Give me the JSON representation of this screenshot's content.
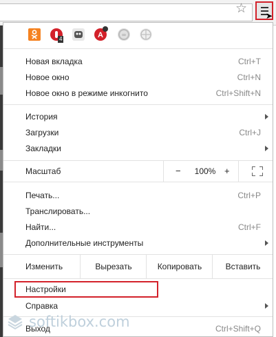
{
  "toolbar": {
    "star_icon": "star-icon",
    "menu_icon": "hamburger-menu-icon"
  },
  "extensions": [
    {
      "name": "odnoklassniki",
      "color": "#f58220"
    },
    {
      "name": "adblock",
      "color": "#d3212a",
      "badge": "4"
    },
    {
      "name": "ghostery",
      "color": "#555555"
    },
    {
      "name": "translate",
      "color": "#d3212a"
    },
    {
      "name": "lastpass",
      "color": "#cccccc"
    },
    {
      "name": "globe",
      "color": "#bfbfbf"
    }
  ],
  "menu": {
    "new_tab": {
      "label": "Новая вкладка",
      "shortcut": "Ctrl+T"
    },
    "new_window": {
      "label": "Новое окно",
      "shortcut": "Ctrl+N"
    },
    "incognito": {
      "label": "Новое окно в режиме инкогнито",
      "shortcut": "Ctrl+Shift+N"
    },
    "history": {
      "label": "История"
    },
    "downloads": {
      "label": "Загрузки",
      "shortcut": "Ctrl+J"
    },
    "bookmarks": {
      "label": "Закладки"
    },
    "zoom": {
      "label": "Масштаб",
      "minus": "−",
      "value": "100%",
      "plus": "+"
    },
    "print": {
      "label": "Печать...",
      "shortcut": "Ctrl+P"
    },
    "cast": {
      "label": "Транслировать..."
    },
    "find": {
      "label": "Найти...",
      "shortcut": "Ctrl+F"
    },
    "more_tools": {
      "label": "Дополнительные инструменты"
    },
    "edit": {
      "label": "Изменить",
      "cut": "Вырезать",
      "copy": "Копировать",
      "paste": "Вставить"
    },
    "settings": {
      "label": "Настройки"
    },
    "help": {
      "label": "Справка"
    },
    "exit": {
      "label": "Выход",
      "shortcut": "Ctrl+Shift+Q"
    }
  },
  "highlight_color": "#d3212a",
  "watermark": {
    "text": "softikbox.com"
  }
}
